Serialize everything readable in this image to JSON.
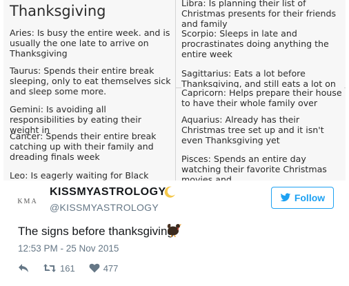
{
  "image": {
    "title": "Thanksgiving",
    "left_entries": [
      "Aries: Is busy the entire week. and is usually the one late to arrive on Thanksgiving",
      "Taurus: Spends their entire break sleeping, only to eat themselves sick and sleep some more.",
      "Gemini: Is avoiding all responsibilities by eating their weight in",
      "Cancer: Spends their entire break catching up with their family and dreading finals week",
      "Leo: Is eagerly waiting for Black Friday"
    ],
    "right_top_entries": [
      "Libra: Is planning their list of Christmas presents for their friends and family",
      "Scorpio: Sleeps in late and procrastinates doing anything the entire week",
      "Sagittarius: Eats a lot before Thanksgiving, and still eats a lot on"
    ],
    "right_bottom_entries": [
      "Capricorn: Helps prepare their house to have their whole family over",
      "Aquarius: Already has their Christmas tree set up and it isn't even Thanksgiving yet",
      "Pisces: Spends an entire day watching their favorite Christmas movies and"
    ]
  },
  "tweet": {
    "avatar_text": "KMA",
    "display_name": "KISSMYASTROLOGY",
    "handle": "@KISSMYASTROLOGY",
    "follow_label": "Follow",
    "text": "The signs before thanksgiving",
    "timestamp": "12:53 PM - 25 Nov 2015",
    "retweets": "161",
    "likes": "477"
  },
  "colors": {
    "accent": "#1da1f2",
    "muted": "#657786"
  },
  "icons": [
    "crescent-moon-icon",
    "turkey-icon",
    "twitter-bird-icon",
    "reply-icon",
    "retweet-icon",
    "heart-icon"
  ]
}
